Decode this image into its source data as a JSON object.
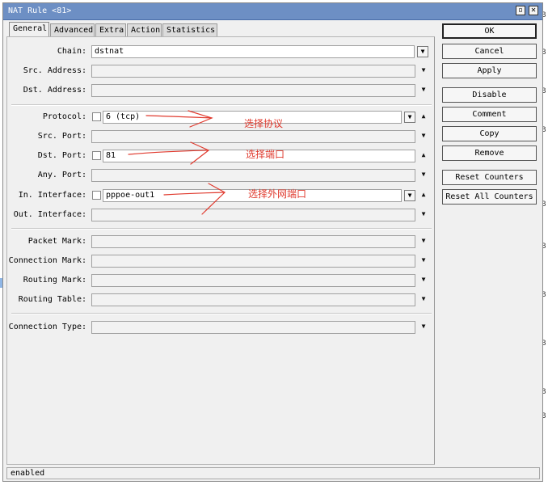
{
  "window": {
    "title": "NAT Rule <81>",
    "status": "enabled"
  },
  "tabs": [
    "General",
    "Advanced",
    "Extra",
    "Action",
    "Statistics"
  ],
  "fields": {
    "chain": {
      "label": "Chain:",
      "value": "dstnat"
    },
    "src_address": {
      "label": "Src. Address:",
      "value": ""
    },
    "dst_address": {
      "label": "Dst. Address:",
      "value": ""
    },
    "protocol": {
      "label": "Protocol:",
      "value": "6 (tcp)"
    },
    "src_port": {
      "label": "Src. Port:",
      "value": ""
    },
    "dst_port": {
      "label": "Dst. Port:",
      "value": "81"
    },
    "any_port": {
      "label": "Any. Port:",
      "value": ""
    },
    "in_interface": {
      "label": "In. Interface:",
      "value": "pppoe-out1"
    },
    "out_interface": {
      "label": "Out. Interface:",
      "value": ""
    },
    "packet_mark": {
      "label": "Packet Mark:",
      "value": ""
    },
    "connection_mark": {
      "label": "Connection Mark:",
      "value": ""
    },
    "routing_mark": {
      "label": "Routing Mark:",
      "value": ""
    },
    "routing_table": {
      "label": "Routing Table:",
      "value": ""
    },
    "connection_type": {
      "label": "Connection Type:",
      "value": ""
    }
  },
  "buttons": {
    "ok": "OK",
    "cancel": "Cancel",
    "apply": "Apply",
    "disable": "Disable",
    "comment": "Comment",
    "copy": "Copy",
    "remove": "Remove",
    "reset_counters": "Reset Counters",
    "reset_all_counters": "Reset All Counters"
  },
  "annotations": {
    "protocol_note": "选择协议",
    "port_note": "选择端口",
    "interface_note": "选择外网端口"
  },
  "background": {
    "edge_letter": "B"
  },
  "colors": {
    "annotation": "#e03a2e",
    "titlebar": "#6d8fc4"
  }
}
